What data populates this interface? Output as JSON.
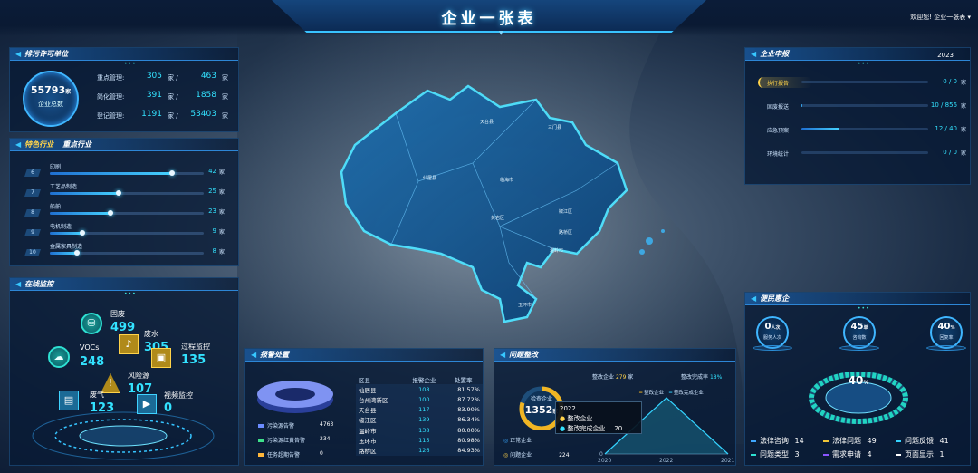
{
  "header": {
    "title": "企业一张表",
    "welcome": "欢迎您! 企业一张表"
  },
  "permit": {
    "title": "排污许可单位",
    "total": "55793",
    "total_unit": "家",
    "total_label": "企业总数",
    "rows": [
      {
        "label": "重点管理:",
        "a": "305",
        "b": "463"
      },
      {
        "label": "简化管理:",
        "a": "391",
        "b": "1858"
      },
      {
        "label": "登记管理:",
        "a": "1191",
        "b": "53403"
      }
    ],
    "unit": "家",
    "sep": "/"
  },
  "industry": {
    "title_a": "特色行业",
    "title_b": "重点行业",
    "items": [
      {
        "rank": "6",
        "name": "印刷",
        "value": "42",
        "pct": 0.8
      },
      {
        "rank": "7",
        "name": "工艺品制造",
        "value": "25",
        "pct": 0.45
      },
      {
        "rank": "8",
        "name": "船舶",
        "value": "23",
        "pct": 0.4
      },
      {
        "rank": "9",
        "name": "电机制造",
        "value": "9",
        "pct": 0.22
      },
      {
        "rank": "10",
        "name": "金属家具制造",
        "value": "8",
        "pct": 0.18
      }
    ],
    "unit": "家"
  },
  "monitor": {
    "title": "在线监控",
    "items": [
      {
        "name": "固废",
        "value": "499"
      },
      {
        "name": "废水",
        "value": "305"
      },
      {
        "name": "VOCs",
        "value": "248"
      },
      {
        "name": "过程监控",
        "value": "135"
      },
      {
        "name": "风险源",
        "value": "107"
      },
      {
        "name": "废气",
        "value": "123"
      },
      {
        "name": "视频监控",
        "value": "0"
      }
    ]
  },
  "alarm": {
    "title": "报警处置",
    "headers": [
      "区县",
      "报警企业",
      "处置率"
    ],
    "rows": [
      [
        "仙居县",
        "108",
        "81.57%"
      ],
      [
        "台州湾新区",
        "100",
        "87.72%"
      ],
      [
        "天台县",
        "117",
        "83.90%"
      ],
      [
        "椒江区",
        "139",
        "86.34%"
      ],
      [
        "温岭市",
        "138",
        "80.00%"
      ],
      [
        "玉环市",
        "115",
        "80.98%"
      ],
      [
        "路桥区",
        "126",
        "84.93%"
      ]
    ],
    "legend": [
      {
        "name": "污染源告警",
        "value": "4763",
        "color": "#6b8cff"
      },
      {
        "name": "污染源红黄告警",
        "value": "234",
        "color": "#3ee08a"
      },
      {
        "name": "任务超期告警",
        "value": "0",
        "color": "#ffb63a"
      }
    ]
  },
  "rectify": {
    "title": "问题整改",
    "top_a_label": "整改企业",
    "top_a_value": "279",
    "top_a_unit": "家",
    "top_b_label": "整改完成率",
    "top_b_value": "18%",
    "ring_label": "检查企业",
    "ring_value": "1352",
    "ring_unit": "家",
    "normal_label": "正常企业",
    "problem_label": "问题企业",
    "problem_value": "224",
    "legend": [
      "整改企业",
      "整改完成企业"
    ],
    "tooltip": {
      "year": "2022",
      "line1": "整改企业",
      "line2": "整改完成企业",
      "line2_value": "20"
    }
  },
  "chart_data": {
    "type": "line",
    "x": [
      "2020",
      "2022",
      "2021"
    ],
    "series": [
      {
        "name": "整改企业",
        "values": [
          0,
          null,
          0
        ]
      },
      {
        "name": "整改完成企业",
        "values": [
          0,
          20,
          0
        ]
      }
    ],
    "ylim": [
      0,
      20
    ]
  },
  "report": {
    "title": "企业申报",
    "year": "2023",
    "items": [
      {
        "name": "执行报告",
        "value": "0 / 0",
        "pct": 0.0,
        "active": true
      },
      {
        "name": "固废报送",
        "value": "10 / 856",
        "pct": 0.01
      },
      {
        "name": "应急预案",
        "value": "12 / 40",
        "pct": 0.3
      },
      {
        "name": "环境统计",
        "value": "0 / 0",
        "pct": 0.0
      }
    ],
    "unit": "家"
  },
  "service": {
    "title": "便民惠企",
    "stats": [
      {
        "value": "0",
        "unit": "人次",
        "label": "服务人次"
      },
      {
        "value": "45",
        "unit": "单",
        "label": "咨询数"
      },
      {
        "value": "40",
        "unit": "%",
        "label": "回复率"
      }
    ],
    "gauge_value": "40",
    "gauge_unit": "%",
    "gauge_pct": 0.4,
    "legend": [
      {
        "name": "法律咨询",
        "value": "14",
        "color": "#3fa7ff"
      },
      {
        "name": "法律问题",
        "value": "49",
        "color": "#f0c537"
      },
      {
        "name": "问题反馈",
        "value": "41",
        "color": "#34d3ff"
      },
      {
        "name": "问题类型",
        "value": "3",
        "color": "#2ee0d2"
      },
      {
        "name": "需求申请",
        "value": "4",
        "color": "#8a55ff"
      },
      {
        "name": "页面显示",
        "value": "1",
        "color": "#ffffff"
      }
    ]
  },
  "map": {
    "labels": [
      "天台县",
      "三门县",
      "仙居县",
      "临海市",
      "椒江区",
      "黄岩区",
      "路桥区",
      "温岭市",
      "玉环市"
    ]
  },
  "colors": {
    "accent": "#33e2ff",
    "panel": "#081a34",
    "yellow": "#ffd34a"
  }
}
